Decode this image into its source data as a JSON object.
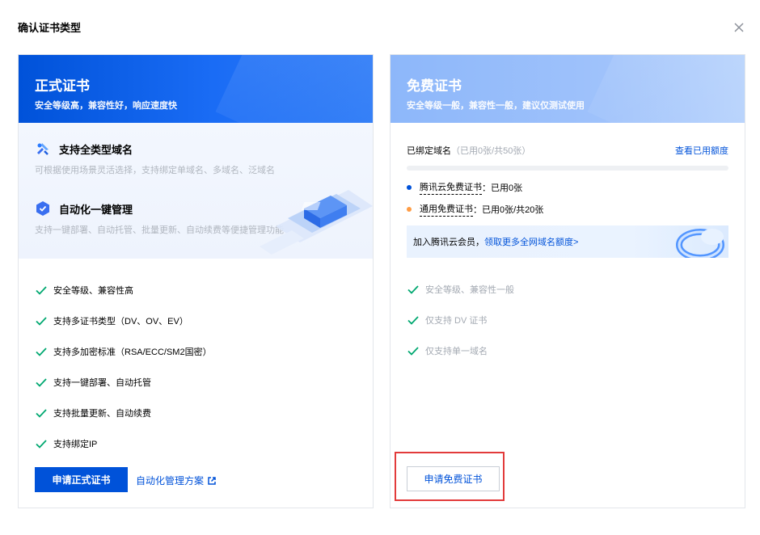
{
  "dialog": {
    "title": "确认证书类型"
  },
  "formal": {
    "title": "正式证书",
    "subtitle": "安全等级高，兼容性好，响应速度快",
    "features": [
      {
        "icon": "domain-icon",
        "title": "支持全类型域名",
        "desc": "可根据使用场景灵活选择，支持绑定单域名、多域名、泛域名"
      },
      {
        "icon": "automation-icon",
        "title": "自动化一键管理",
        "desc": "支持一键部署、自动托管、批量更新、自动续费等便捷管理功能"
      }
    ],
    "checks": [
      "安全等级、兼容性高",
      "支持多证书类型（DV、OV、EV）",
      "支持多加密标准（RSA/ECC/SM2国密）",
      "支持一键部署、自动托管",
      "支持批量更新、自动续费",
      "支持绑定IP"
    ],
    "apply_label": "申请正式证书",
    "auto_link_label": "自动化管理方案"
  },
  "free": {
    "title": "免费证书",
    "subtitle": "安全等级一般，兼容性一般，建议仅测试使用",
    "bind_label": "已绑定域名",
    "bind_usage": "（已用0张/共50张）",
    "view_quota_label": "查看已用额度",
    "usage_fraction": 0,
    "quotas": [
      {
        "name": "腾讯云免费证书",
        "usage": "：已用0张",
        "color": "#0052d9"
      },
      {
        "name": "通用免费证书",
        "usage": "：已用0张/共20张",
        "color": "#ff9c44"
      }
    ],
    "promo_text": "加入腾讯云会员，",
    "promo_link": "领取更多全网域名额度>",
    "checks": [
      "安全等级、兼容性一般",
      "仅支持 DV 证书",
      "仅支持单一域名"
    ],
    "apply_label": "申请免费证书"
  },
  "colors": {
    "primary": "#0052d9",
    "check": "#00a870",
    "highlight": "#e23b3b"
  }
}
